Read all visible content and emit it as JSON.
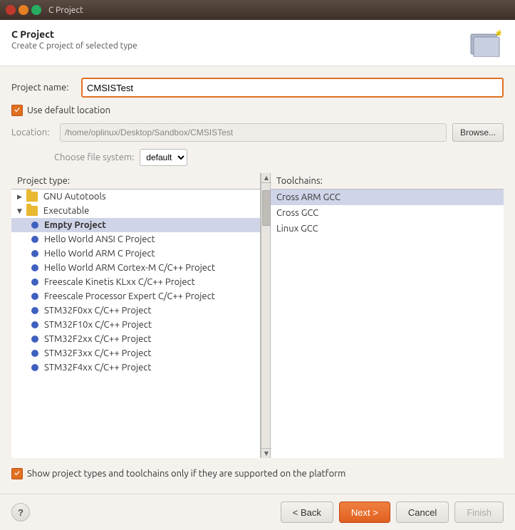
{
  "titleBar": {
    "title": "C Project",
    "closeBtn": "×",
    "minimizeBtn": "−",
    "maximizeBtn": "□"
  },
  "header": {
    "title": "C Project",
    "subtitle": "Create C project of selected type"
  },
  "form": {
    "projectNameLabel": "Project name:",
    "projectNameValue": "CMSISTest",
    "useDefaultLocationLabel": "Use default location",
    "locationLabel": "Location:",
    "locationValue": "/home/oplinux/Desktop/Sandbox/CMSISTest",
    "browseLabel": "Browse...",
    "fileSystemLabel": "Choose file system:",
    "fileSystemValue": "default"
  },
  "projectType": {
    "header": "Project type:",
    "items": [
      {
        "id": "gnu-autotools",
        "label": "GNU Autotools",
        "indent": 0,
        "type": "folder-arrow",
        "selected": false
      },
      {
        "id": "executable",
        "label": "Executable",
        "indent": 0,
        "type": "folder-open",
        "selected": false
      },
      {
        "id": "empty-project",
        "label": "Empty Project",
        "indent": 2,
        "type": "dot",
        "selected": true
      },
      {
        "id": "hello-world-ansi",
        "label": "Hello World ANSI C Project",
        "indent": 2,
        "type": "dot",
        "selected": false
      },
      {
        "id": "hello-world-arm",
        "label": "Hello World ARM C Project",
        "indent": 2,
        "type": "dot",
        "selected": false
      },
      {
        "id": "hello-world-cortex",
        "label": "Hello World ARM Cortex-M C/C++ Project",
        "indent": 2,
        "type": "dot",
        "selected": false
      },
      {
        "id": "freescale-kinetis",
        "label": "Freescale Kinetis KLxx C/C++ Project",
        "indent": 2,
        "type": "dot",
        "selected": false
      },
      {
        "id": "freescale-processor",
        "label": "Freescale Processor Expert C/C++ Project",
        "indent": 2,
        "type": "dot",
        "selected": false
      },
      {
        "id": "stm32f0xx",
        "label": "STM32F0xx C/C++ Project",
        "indent": 2,
        "type": "dot",
        "selected": false
      },
      {
        "id": "stm32f10x",
        "label": "STM32F10x C/C++ Project",
        "indent": 2,
        "type": "dot",
        "selected": false
      },
      {
        "id": "stm32f2xx",
        "label": "STM32F2xx C/C++ Project",
        "indent": 2,
        "type": "dot",
        "selected": false
      },
      {
        "id": "stm32f3xx",
        "label": "STM32F3xx C/C++ Project",
        "indent": 2,
        "type": "dot",
        "selected": false
      },
      {
        "id": "stm32f4xx",
        "label": "STM32F4xx C/C++ Project",
        "indent": 2,
        "type": "dot",
        "selected": false
      }
    ]
  },
  "toolchains": {
    "header": "Toolchains:",
    "items": [
      {
        "id": "cross-arm-gcc",
        "label": "Cross ARM GCC",
        "selected": true
      },
      {
        "id": "cross-gcc",
        "label": "Cross GCC",
        "selected": false
      },
      {
        "id": "linux-gcc",
        "label": "Linux GCC",
        "selected": false
      }
    ]
  },
  "bottomCheckbox": {
    "label": "Show project types and toolchains only if they are supported on the platform"
  },
  "footer": {
    "helpLabel": "?",
    "backLabel": "< Back",
    "nextLabel": "Next >",
    "cancelLabel": "Cancel",
    "finishLabel": "Finish"
  }
}
